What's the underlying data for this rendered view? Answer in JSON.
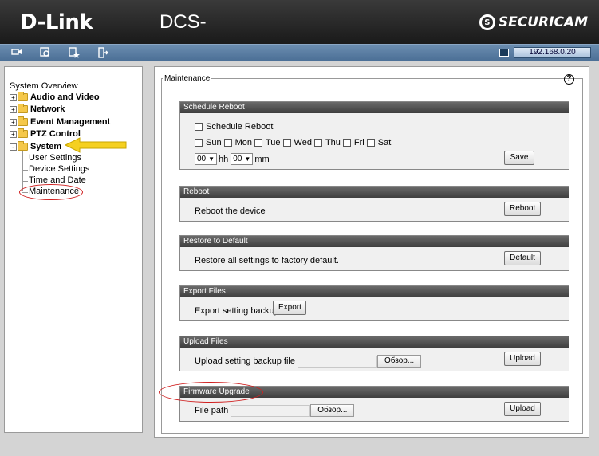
{
  "header": {
    "logo": "D-Link",
    "model": "DCS-",
    "brand": "SECURICAM",
    "brand_mark": "S"
  },
  "toolbar": {
    "ip": "192.168.0.20",
    "icons": [
      "camera-icon",
      "setup-icon",
      "star-icon",
      "logout-icon"
    ]
  },
  "tree": {
    "title": "System Overview",
    "items": [
      {
        "label": "Audio and Video",
        "expander": "+"
      },
      {
        "label": "Network",
        "expander": "+"
      },
      {
        "label": "Event Management",
        "expander": "+"
      },
      {
        "label": "PTZ Control",
        "expander": "+"
      },
      {
        "label": "System",
        "expander": "-"
      }
    ],
    "system_children": [
      "User Settings",
      "Device Settings",
      "Time and Date",
      "Maintenance"
    ]
  },
  "main": {
    "legend": "Maintenance",
    "help": "?",
    "schedule": {
      "title": "Schedule Reboot",
      "checkbox_label": "Schedule Reboot",
      "days": [
        "Sun",
        "Mon",
        "Tue",
        "Wed",
        "Thu",
        "Fri",
        "Sat"
      ],
      "hour": "00",
      "hour_unit": "hh",
      "minute": "00",
      "minute_unit": "mm",
      "save": "Save"
    },
    "reboot": {
      "title": "Reboot",
      "text": "Reboot the device",
      "button": "Reboot"
    },
    "restore": {
      "title": "Restore to Default",
      "text": "Restore all settings to factory default.",
      "button": "Default"
    },
    "export": {
      "title": "Export Files",
      "text": "Export setting backup file",
      "button": "Export"
    },
    "upload": {
      "title": "Upload Files",
      "text": "Upload setting backup file",
      "browse": "Обзор...",
      "button": "Upload"
    },
    "firmware": {
      "title": "Firmware Upgrade",
      "text": "File path",
      "browse": "Обзор...",
      "button": "Upload"
    }
  },
  "colors": {
    "header": "#1a1a1a",
    "toolbar": "#4a6e95",
    "section_head": "#4a4a4a",
    "annotation_red": "#d02020",
    "annotation_arrow": "#f5d020"
  }
}
